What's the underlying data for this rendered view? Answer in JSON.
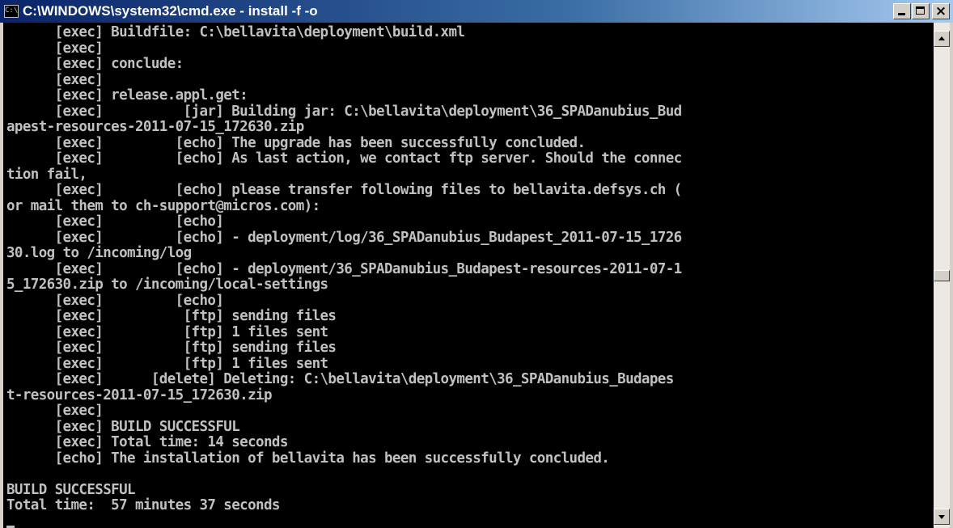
{
  "window": {
    "title": "C:\\WINDOWS\\system32\\cmd.exe - install -f -o",
    "app_icon_glyph": "C:\\"
  },
  "console": {
    "lines": [
      "      [exec] Buildfile: C:\\bellavita\\deployment\\build.xml",
      "      [exec]",
      "      [exec] conclude:",
      "      [exec]",
      "      [exec] release.appl.get:",
      "      [exec]          [jar] Building jar: C:\\bellavita\\deployment\\36_SPADanubius_Bud",
      "apest-resources-2011-07-15_172630.zip",
      "      [exec]         [echo] The upgrade has been successfully concluded.",
      "      [exec]         [echo] As last action, we contact ftp server. Should the connec",
      "tion fail,",
      "      [exec]         [echo] please transfer following files to bellavita.defsys.ch (",
      "or mail them to ch-support@micros.com):",
      "      [exec]         [echo]",
      "      [exec]         [echo] - deployment/log/36_SPADanubius_Budapest_2011-07-15_1726",
      "30.log to /incoming/log",
      "      [exec]         [echo] - deployment/36_SPADanubius_Budapest-resources-2011-07-1",
      "5_172630.zip to /incoming/local-settings",
      "      [exec]         [echo]",
      "      [exec]          [ftp] sending files",
      "      [exec]          [ftp] 1 files sent",
      "      [exec]          [ftp] sending files",
      "      [exec]          [ftp] 1 files sent",
      "      [exec]      [delete] Deleting: C:\\bellavita\\deployment\\36_SPADanubius_Budapes",
      "t-resources-2011-07-15_172630.zip",
      "      [exec]",
      "      [exec] BUILD SUCCESSFUL",
      "      [exec] Total time: 14 seconds",
      "      [echo] The installation of bellavita has been successfully concluded.",
      "",
      "BUILD SUCCESSFUL",
      "Total time:  57 minutes 37 seconds",
      ""
    ],
    "text_color": "#c0c0c0",
    "background_color": "#000000"
  },
  "icons": {
    "minimize": "minimize-icon",
    "maximize": "maximize-icon",
    "close": "close-icon",
    "scroll_up": "arrow-up-icon",
    "scroll_down": "arrow-down-icon"
  }
}
